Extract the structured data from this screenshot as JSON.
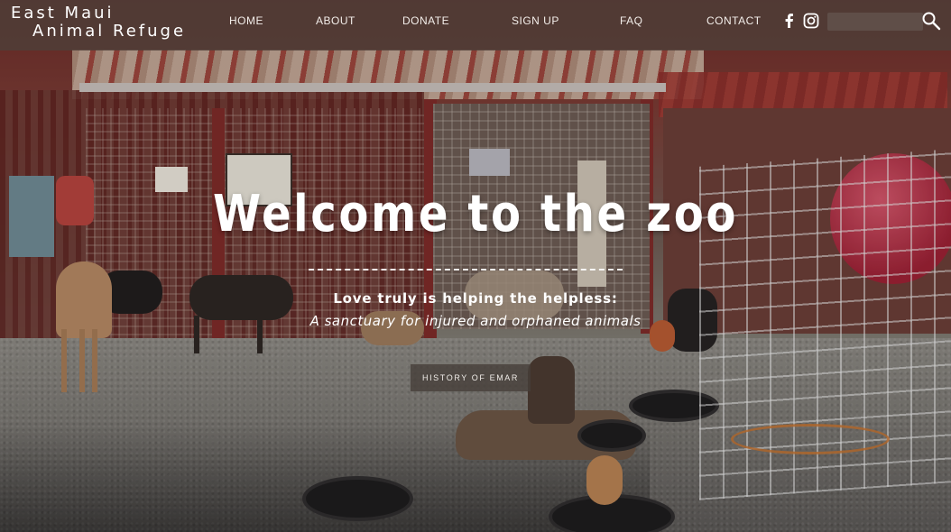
{
  "brand": {
    "line1": "East Maui",
    "line2": "Animal Refuge"
  },
  "nav": [
    {
      "label": "HOME"
    },
    {
      "label": "ABOUT"
    },
    {
      "label": "DONATE"
    },
    {
      "label": "SIGN UP"
    },
    {
      "label": "FAQ"
    },
    {
      "label": "CONTACT"
    }
  ],
  "social": {
    "facebook": "facebook-icon",
    "instagram": "instagram-icon"
  },
  "search": {
    "value": "",
    "placeholder": ""
  },
  "hero": {
    "title": "Welcome to the zoo",
    "tagline": "Love truly is helping the helpless:",
    "subline": "A sanctuary for injured and orphaned animals",
    "button_label": "HISTORY OF EMAR"
  },
  "photo": {
    "sign_text": "East Maui Animal Refuge"
  },
  "colors": {
    "header_bg": "#4e3e38",
    "text": "#ffffff",
    "button_bg": "#463e3a"
  }
}
